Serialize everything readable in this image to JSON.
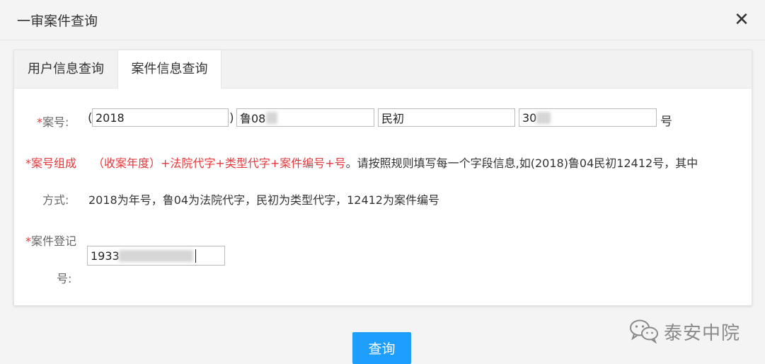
{
  "dialog": {
    "title": "一审案件查询",
    "close_glyph": "✕"
  },
  "tabs": [
    {
      "label": "用户信息查询",
      "active": false
    },
    {
      "label": "案件信息查询",
      "active": true
    }
  ],
  "case_number": {
    "required_mark": "*",
    "label": "案号:",
    "open_paren": "(",
    "close_paren": ")",
    "year_value": "2018",
    "court_value": "鲁08",
    "type_value": "民初",
    "number_value": "30",
    "suffix": "号"
  },
  "format": {
    "required_mark": "*",
    "label_line1": "案号组成",
    "label_line2": "方式:",
    "rule_red": "（收案年度）+法院代字+类型代字+案件编号+号",
    "rule_dark": "。请按照规则填写每一个字段信息,如(2018)鲁04民初12412号，其中",
    "rule_line2": "2018为年号，鲁04为法院代字，民初为类型代字，12412为案件编号"
  },
  "registration": {
    "required_mark": "*",
    "label_line1": "案件登记",
    "label_line2": "号:",
    "value": "1933"
  },
  "query_button": "查询",
  "watermark": {
    "icon": "wechat-icon",
    "text": "泰安中院"
  },
  "colors": {
    "required": "#e4393c",
    "primary_button": "#1e9fff"
  }
}
